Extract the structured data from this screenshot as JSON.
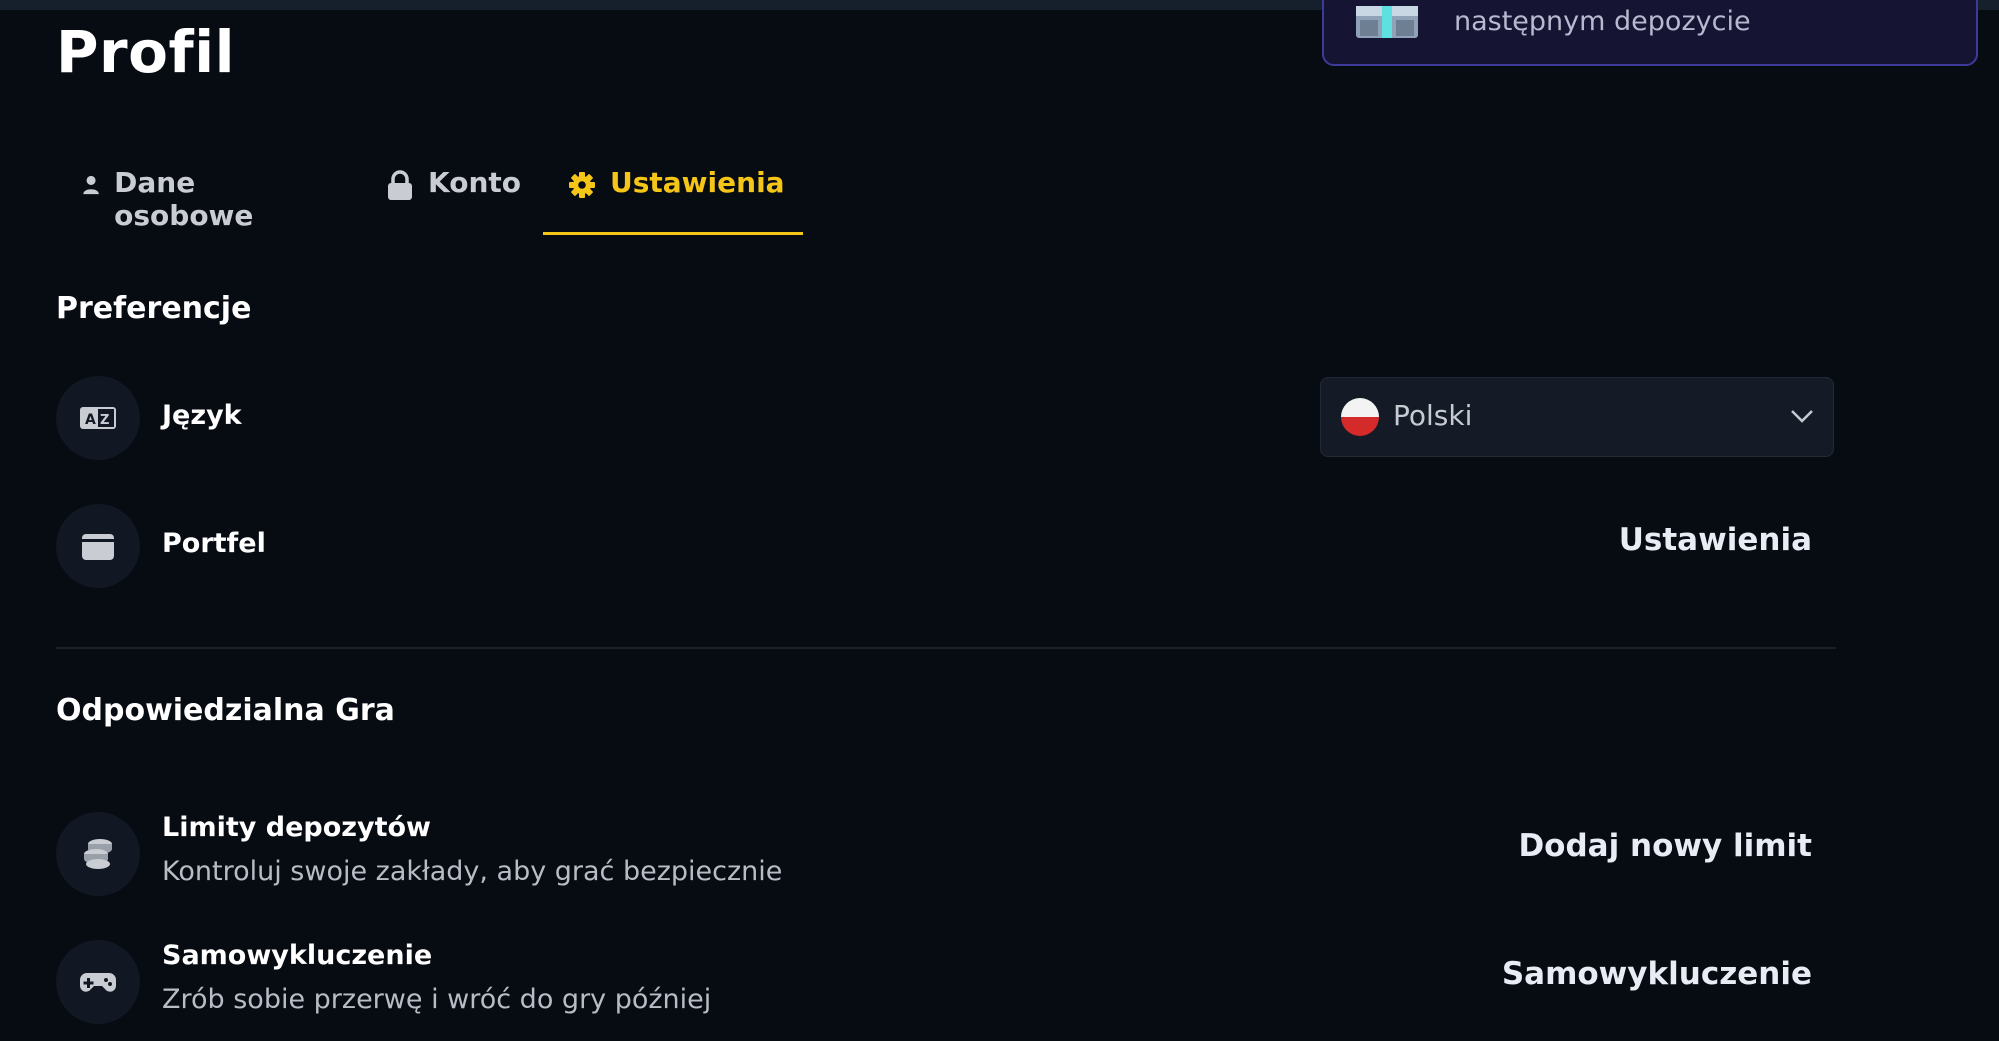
{
  "header": {
    "title": "Profil",
    "promo_text": "następnym depozycie",
    "promo_icon": "gift-box-icon"
  },
  "tabs": [
    {
      "label": "Dane osobowe",
      "icon": "user-icon",
      "active": false
    },
    {
      "label": "Konto",
      "icon": "lock-icon",
      "active": false
    },
    {
      "label": "Ustawienia",
      "icon": "gear-icon",
      "active": true
    }
  ],
  "preferences": {
    "title": "Preferencje",
    "language": {
      "label": "Język",
      "icon": "language-icon",
      "selected": "Polski",
      "flag": "poland-flag-icon"
    },
    "wallet": {
      "label": "Portfel",
      "icon": "wallet-icon",
      "action": "Ustawienia"
    }
  },
  "responsible": {
    "title": "Odpowiedzialna Gra",
    "deposit_limits": {
      "label": "Limity depozytów",
      "subtitle": "Kontroluj swoje zakłady, aby grać bezpiecznie",
      "icon": "coins-icon",
      "action": "Dodaj nowy limit"
    },
    "self_exclusion": {
      "label": "Samowykluczenie",
      "subtitle": "Zrób sobie przerwę i wróć do gry później",
      "icon": "gamepad-icon",
      "action": "Samowykluczenie"
    }
  },
  "colors": {
    "background": "#070b12",
    "accent": "#f5c518",
    "promo_border": "#3d3a9a"
  }
}
